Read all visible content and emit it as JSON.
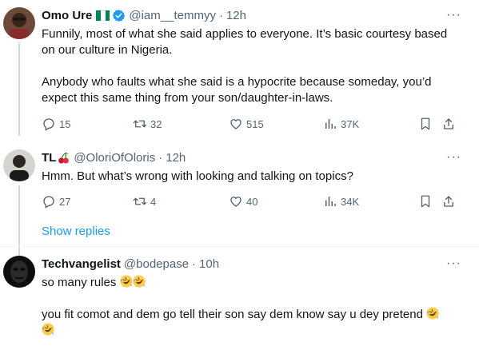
{
  "tweets": [
    {
      "name": "Omo Ure",
      "handle": "@iam__temmyy",
      "dot": "·",
      "time": "12h",
      "more": "···",
      "paragraphs": [
        "Funnily, most of what she said applies to everyone. It’s basic courtesy based on our culture in Nigeria.",
        "Anybody who faults what she said is a hypocrite because someday, you’d expect this same thing from your son/daughter-in-laws."
      ],
      "replies": "15",
      "retweets": "32",
      "likes": "515",
      "views": "37K",
      "badges": [
        "nigeria-flag",
        "verified-badge"
      ]
    },
    {
      "name": "TL",
      "handle": "@OloriOfOloris",
      "dot": "·",
      "time": "12h",
      "more": "···",
      "paragraphs": [
        "Hmm. But what’s wrong with looking and talking on topics?"
      ],
      "replies": "27",
      "retweets": "4",
      "likes": "40",
      "views": "34K",
      "badges": [
        "cherries-emoji"
      ]
    },
    {
      "name": "Techvangelist",
      "handle": "@bodepase",
      "dot": "·",
      "time": "10h",
      "more": "···",
      "paragraphs": [
        "so many rules",
        "you fit comot and dem go tell their son say dem know say u dey pretend"
      ],
      "emojis": [
        "rofl-emoji"
      ]
    }
  ],
  "show_replies": "Show replies",
  "colors": {
    "accent": "#1d9bf0",
    "text": "#0f1419",
    "secondary": "#536471",
    "thread_line": "#cfd9de",
    "divider": "#eff3f4",
    "nigeria_green": "#008751"
  }
}
